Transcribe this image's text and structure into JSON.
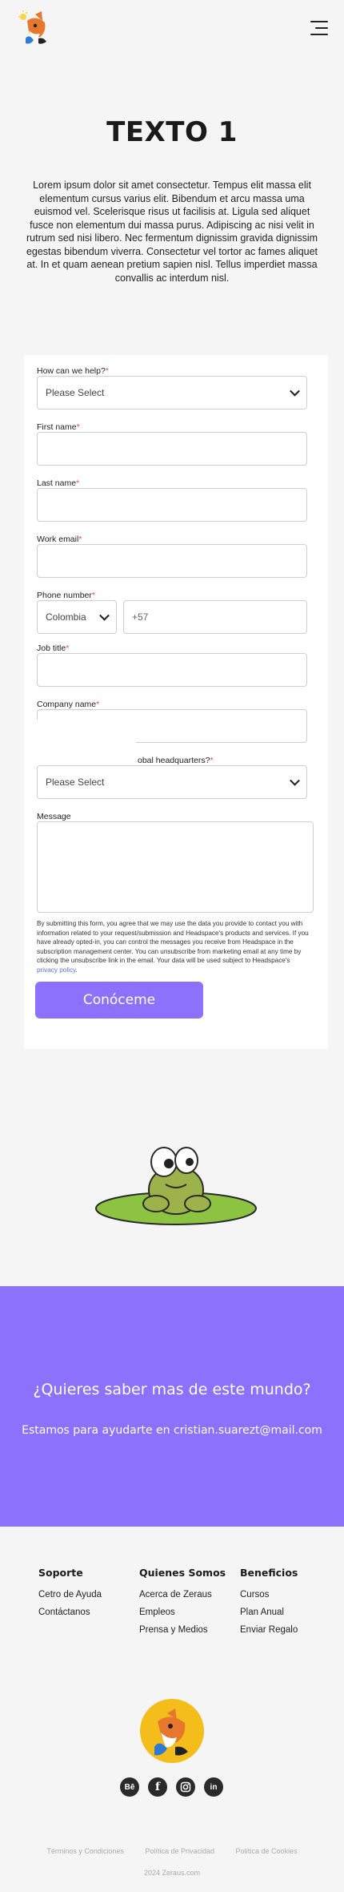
{
  "hero": {
    "title": "TEXTO 1",
    "paragraph": "Lorem ipsum dolor sit amet consectetur. Tempus elit massa elit elementum cursus varius elit. Bibendum et arcu massa uma euismod vel. Scelerisque risus ut facilisis at. Ligula sed aliquet fusce non elementum dui massa purus. Adipiscing ac nisi velit in rutrum sed nisi libero. Nec fermentum dignissim gravida dignissim egestas bibendum viverra. Consectetur vel tortor ac fames aliquet at. In et quam aenean pretium sapien nisl. Tellus imperdiet massa convallis ac interdum nisl."
  },
  "form": {
    "help_label": "How can we help?",
    "help_placeholder": "Please Select",
    "first_name_label": "First name",
    "last_name_label": "Last name",
    "work_email_label": "Work email",
    "phone_label": "Phone number",
    "country_value": "Colombia",
    "phone_prefix": "+57",
    "job_title_label": "Job title",
    "company_label": "Company name",
    "hq_label_visible": "obal headquarters?",
    "hq_placeholder": "Please Select",
    "message_label": "Message",
    "legal_text": "By submitting this form, you agree that we may use the data you provide to contact you with information related to your request/submission and Headspace's products and services. If you have already opted-in, you can control the messages you receive from Headspace in the subscription management center. You can unsubscribe from marketing email at any time by clicking the unsubscribe link in the email. Your data will be used subject to Headspace's",
    "privacy_link": "privacy policy",
    "submit_label": "Conóceme",
    "required_mark": "*"
  },
  "cta": {
    "title": "¿Quieres saber mas de este mundo?",
    "contact": "Estamos para ayudarte en cristian.suarezt@mail.com"
  },
  "footer": {
    "columns": [
      {
        "heading": "Soporte",
        "links": [
          "Cetro de Ayuda",
          "Contáctanos"
        ]
      },
      {
        "heading": "Quienes Somos",
        "links": [
          "Acerca de Zeraus",
          "Empleos",
          "Prensa y Medios"
        ]
      },
      {
        "heading": "Beneficios",
        "links": [
          "Cursos",
          "Plan Anual",
          "Enviar Regalo"
        ]
      }
    ],
    "socials": [
      "behance-icon",
      "facebook-icon",
      "instagram-icon",
      "linkedin-icon"
    ],
    "behance_glyph": "Bē",
    "linkedin_glyph": "in",
    "facebook_glyph": "f",
    "legal_links": [
      "Términos y Condiciones",
      "Política de Privacidad",
      "Política de Cookies"
    ],
    "copyright": "2024 Zeraus.com"
  },
  "colors": {
    "accent": "#8b71fb",
    "badge": "#f3bd1c",
    "required": "#e8523b"
  }
}
